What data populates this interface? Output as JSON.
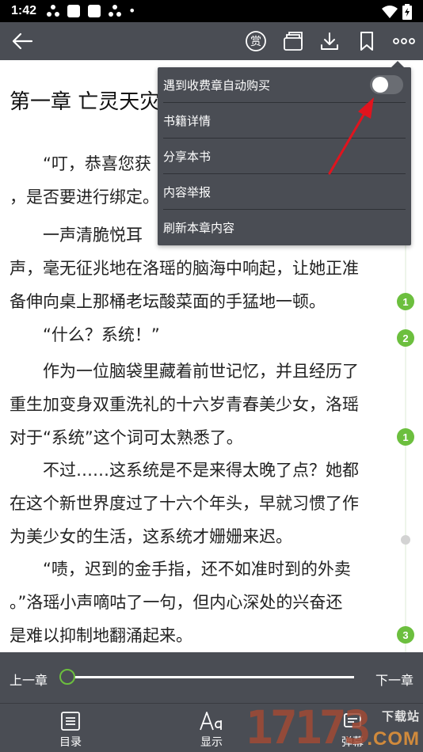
{
  "status_bar": {
    "time": "1:42",
    "dot": "•"
  },
  "toolbar": {
    "back_icon": "back-arrow-icon",
    "reward_glyph": "赏"
  },
  "chapter": {
    "title": "第一章 亡灵天灾",
    "paragraphs": [
      [
        "“叮，恭喜您获",
        "，是否要进行绑定。"
      ],
      [
        "一声清脆悦耳",
        "声，毫无征兆地在洛瑶的脑海中响起，让她正准",
        "备伸向桌上那桶老坛酸菜面的手猛地一顿。"
      ],
      [
        "“什么？系统！”"
      ],
      [
        "作为一位脑袋里藏着前世记忆，并且经历了",
        "重生加变身双重洗礼的十六岁青春美少女，洛瑶",
        "对于“系统”这个词可太熟悉了。"
      ],
      [
        "不过……这系统是不是来得太晚了点？她都",
        "在这个新世界度过了十六个年头，早就习惯了作",
        "为美少女的生活，这系统才姗姗来迟。"
      ],
      [
        "“啧，迟到的金手指，还不如准时到的外卖",
        "。”洛瑶小声嘀咕了一句，但内心深处的兴奋还",
        "是难以抑制地翻涌起来。"
      ]
    ],
    "comment_badges": [
      "1",
      "2",
      "1",
      "3"
    ]
  },
  "menu": {
    "items": [
      {
        "label": "遇到收费章自动购买",
        "toggle": false
      },
      {
        "label": "书籍详情"
      },
      {
        "label": "分享本书"
      },
      {
        "label": "内容举报"
      },
      {
        "label": "刷新本章内容"
      }
    ]
  },
  "chapter_nav": {
    "prev_label": "上一章",
    "next_label": "下一章",
    "progress": 0.0
  },
  "bottom_tabs": [
    {
      "label": "目录",
      "icon": "list-icon"
    },
    {
      "label": "显示",
      "icon": "font-size-icon"
    },
    {
      "label": "弹幕",
      "icon": "danmaku-icon"
    }
  ],
  "watermark": {
    "digits": "17173",
    "top_text": "下载站",
    "bottom_text": ".COM"
  },
  "colors": {
    "toolbar": "#4a4d54",
    "accent_green": "#6cbf3e",
    "annotation_red": "#e0141e"
  }
}
